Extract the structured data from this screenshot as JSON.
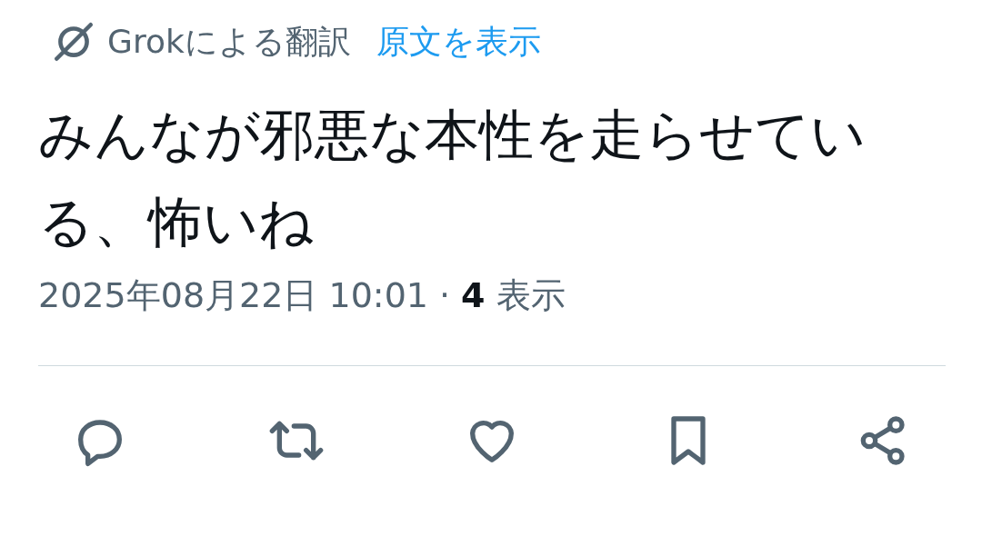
{
  "translation": {
    "label": "Grokによる翻訳",
    "link": "原文を表示"
  },
  "text": "みんなが邪悪な本性を走らせている、怖いね",
  "meta": {
    "timestamp": "2025年08月22日 10:01",
    "separator": "·",
    "views": "4",
    "views_label": "表示"
  }
}
